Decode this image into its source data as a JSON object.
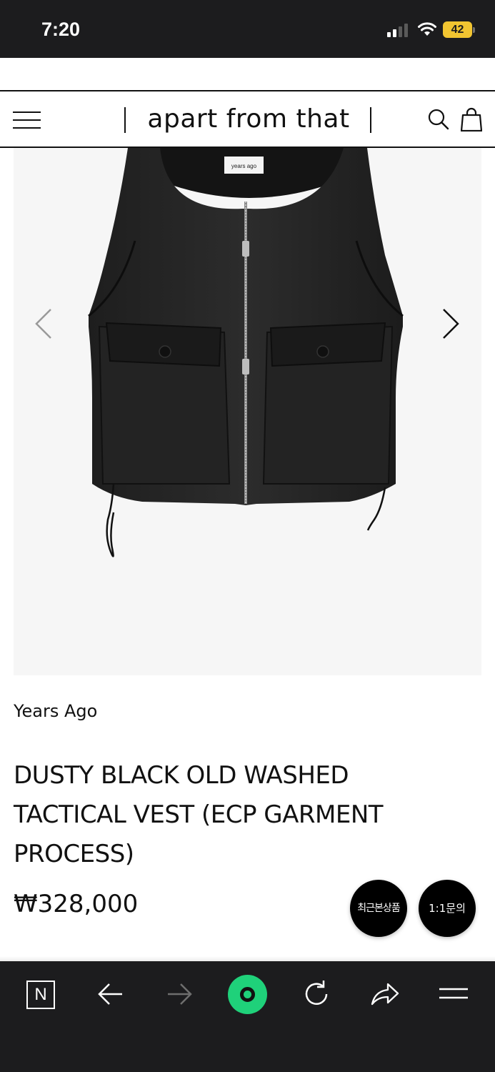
{
  "status_bar": {
    "time": "7:20",
    "battery": "42"
  },
  "header": {
    "logo": "apart from that",
    "icons": [
      "menu-icon",
      "search-icon",
      "bag-icon"
    ]
  },
  "product": {
    "image_label_tag": "years ago",
    "brand": "Years Ago",
    "title": "DUSTY BLACK OLD WASHED TACTICAL VEST (ECP GARMENT PROCESS)",
    "price": "₩328,000"
  },
  "floating_buttons": {
    "recent": "최근본상품",
    "inquiry": "1:1문의"
  },
  "browser_bar": {
    "n_label": "N",
    "icons": [
      "naver-icon",
      "back-arrow-icon",
      "forward-arrow-icon",
      "home-icon",
      "refresh-icon",
      "share-icon",
      "hamburger-icon"
    ]
  },
  "colors": {
    "status_bar_bg": "#1c1c1e",
    "home_button": "#1fd17a",
    "battery": "#f2c531"
  }
}
